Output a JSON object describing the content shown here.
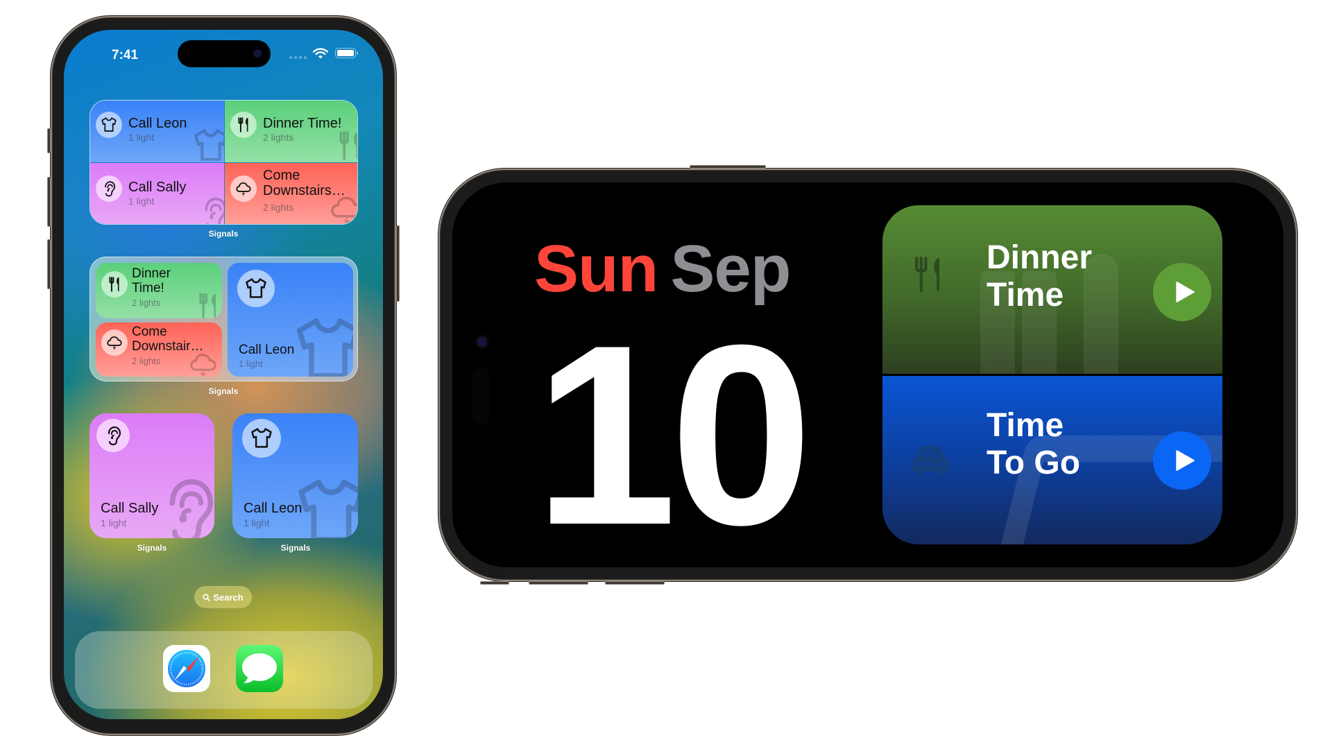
{
  "portrait_phone": {
    "status_bar": {
      "time": "7:41",
      "wifi_icon": "wifi-icon",
      "battery_icon": "battery-full-icon"
    },
    "widgets": [
      {
        "app_label": "Signals",
        "size": "medium-grid",
        "tiles": [
          {
            "title": "Call Leon",
            "subtitle": "1 light",
            "icon": "tshirt-icon",
            "color": "#3a82f8"
          },
          {
            "title": "Dinner Time!",
            "subtitle": "2 lights",
            "icon": "fork-knife-icon",
            "color": "#5ad07a"
          },
          {
            "title": "Call Sally",
            "subtitle": "1 light",
            "icon": "ear-icon",
            "color": "#dc7cf8"
          },
          {
            "title": "Come Downstairs…",
            "subtitle": "2 lights",
            "icon": "cloud-bolt-icon",
            "color": "#ff6357"
          }
        ]
      },
      {
        "app_label": "Signals",
        "size": "medium-split",
        "tiles": [
          {
            "title_line1": "Dinner",
            "title_line2": "Time!",
            "subtitle": "2 lights",
            "icon": "fork-knife-icon",
            "color": "#5ad07a"
          },
          {
            "title_line1": "Come",
            "title_line2": "Downstair…",
            "subtitle": "2 lights",
            "icon": "cloud-bolt-icon",
            "color": "#ff6357"
          },
          {
            "title": "Call Leon",
            "subtitle": "1 light",
            "icon": "tshirt-icon",
            "color": "#3a82f8"
          }
        ]
      },
      {
        "app_label": "Signals",
        "size": "small",
        "title": "Call Sally",
        "subtitle": "1 light",
        "icon": "ear-icon",
        "color": "#dc7cf8"
      },
      {
        "app_label": "Signals",
        "size": "small",
        "title": "Call Leon",
        "subtitle": "1 light",
        "icon": "tshirt-icon",
        "color": "#3a82f8"
      }
    ],
    "search": {
      "label": "Search",
      "icon": "magnifier-icon"
    },
    "dock": [
      {
        "app": "Safari",
        "icon": "safari-compass-icon"
      },
      {
        "app": "Messages",
        "icon": "messages-bubble-icon"
      }
    ]
  },
  "landscape_phone": {
    "standby": {
      "day": "Sun",
      "month": "Sep",
      "date": "10",
      "day_color": "#ff453a",
      "month_color": "#8e8e93"
    },
    "widget_stack": [
      {
        "title_line1": "Dinner",
        "title_line2": "Time",
        "icon": "fork-knife-icon",
        "action": "play-icon",
        "accent": "#5e9e36"
      },
      {
        "title_line1": "Time",
        "title_line2": "To Go",
        "icon": "car-icon",
        "action": "play-icon",
        "accent": "#0a66f5"
      }
    ]
  }
}
